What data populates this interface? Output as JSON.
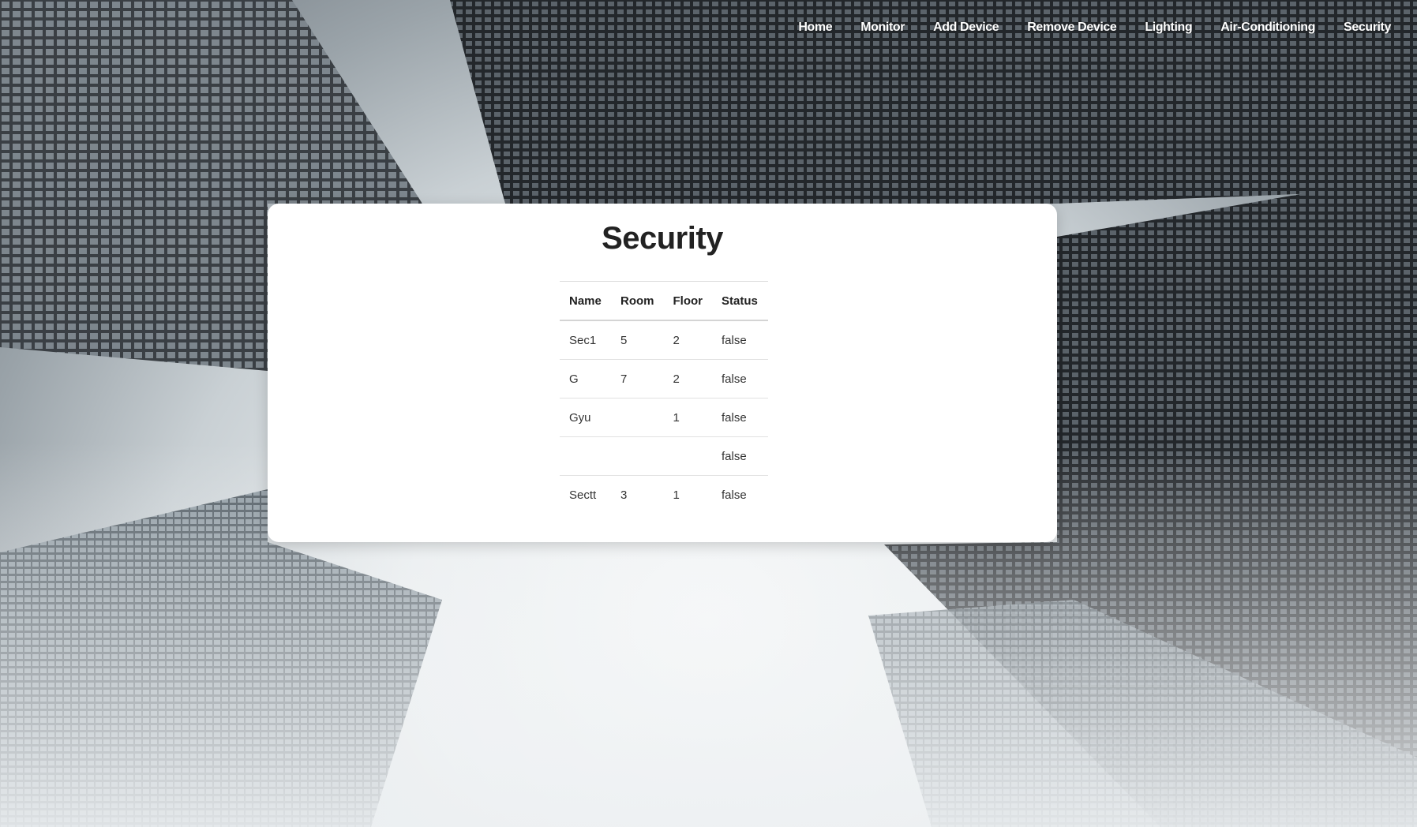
{
  "nav": {
    "items": [
      {
        "label": "Home"
      },
      {
        "label": "Monitor"
      },
      {
        "label": "Add Device"
      },
      {
        "label": "Remove Device"
      },
      {
        "label": "Lighting"
      },
      {
        "label": "Air-Conditioning"
      },
      {
        "label": "Security"
      }
    ]
  },
  "card": {
    "title": "Security"
  },
  "table": {
    "headers": [
      "Name",
      "Room",
      "Floor",
      "Status"
    ],
    "rows": [
      [
        "Sec1",
        "5",
        "2",
        "false"
      ],
      [
        "G",
        "7",
        "2",
        "false"
      ],
      [
        "Gyu",
        "",
        "1",
        "false"
      ],
      [
        "",
        "",
        "",
        "false"
      ],
      [
        "Sectt",
        "3",
        "1",
        "false"
      ]
    ]
  },
  "colors": {
    "card_bg": "#ffffff",
    "nav_text": "#ffffff",
    "title_text": "#222222"
  }
}
